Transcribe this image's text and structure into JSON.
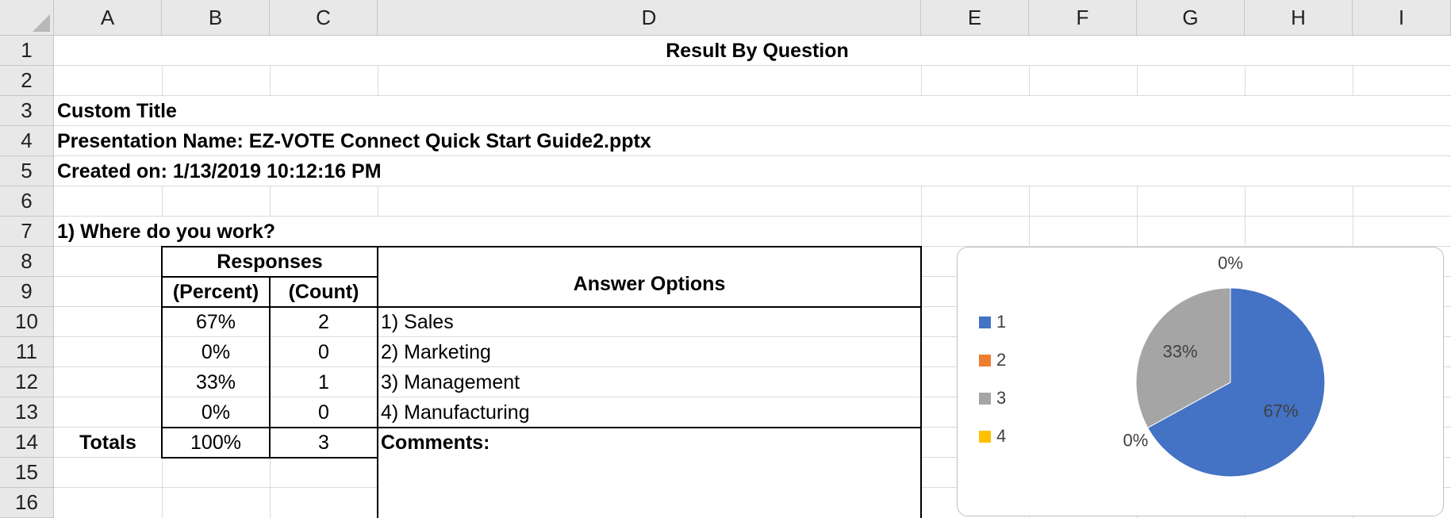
{
  "columns": [
    "A",
    "B",
    "C",
    "D",
    "E",
    "F",
    "G",
    "H",
    "I"
  ],
  "rows": [
    "1",
    "2",
    "3",
    "4",
    "5",
    "6",
    "7",
    "8",
    "9",
    "10",
    "11",
    "12",
    "13",
    "14",
    "15",
    "16"
  ],
  "header": {
    "title": "Result By Question",
    "custom_title": "Custom Title",
    "presentation_name": "Presentation Name: EZ-VOTE Connect Quick Start Guide2.pptx",
    "created_on": "Created on: 1/13/2019 10:12:16 PM"
  },
  "question": {
    "text": "1) Where do you work?",
    "responses_label": "Responses",
    "percent_label": "(Percent)",
    "count_label": "(Count)",
    "answer_options_label": "Answer Options",
    "rows": [
      {
        "percent": "67%",
        "count": "2",
        "option": "1) Sales"
      },
      {
        "percent": "0%",
        "count": "0",
        "option": "2) Marketing"
      },
      {
        "percent": "33%",
        "count": "1",
        "option": "3) Management"
      },
      {
        "percent": "0%",
        "count": "0",
        "option": "4) Manufacturing"
      }
    ],
    "totals_label": "Totals",
    "totals_percent": "100%",
    "totals_count": "3",
    "comments_label": "Comments:"
  },
  "chart_data": {
    "type": "pie",
    "categories": [
      "1",
      "2",
      "3",
      "4"
    ],
    "values": [
      67,
      0,
      33,
      0
    ],
    "labels": [
      "67%",
      "0%",
      "33%",
      "0%"
    ],
    "colors": [
      "#4472c4",
      "#ed7d31",
      "#a5a5a5",
      "#ffc000"
    ],
    "legend_position": "left"
  }
}
